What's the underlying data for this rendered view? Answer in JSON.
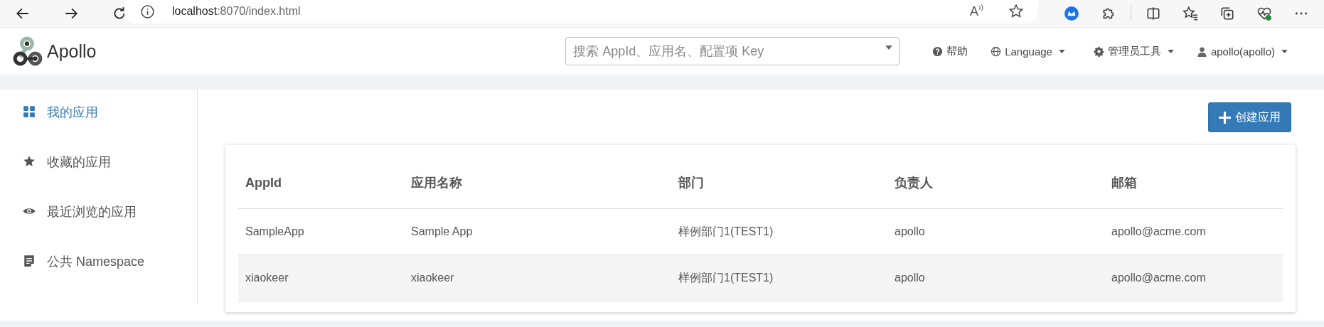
{
  "browser": {
    "url_host": "localhost",
    "url_rest": ":8070/index.html",
    "read_aloud_label": "A"
  },
  "header": {
    "logo_text": "Apollo",
    "search": {
      "placeholder": "搜索 AppId、应用名、配置项 Key"
    },
    "nav": [
      {
        "kind": "help",
        "label": "帮助",
        "dropdown": false
      },
      {
        "kind": "language",
        "label": "Language",
        "dropdown": true
      },
      {
        "kind": "admin",
        "label": "管理员工具",
        "dropdown": true
      },
      {
        "kind": "user",
        "label": "apollo(apollo)",
        "dropdown": true
      }
    ]
  },
  "sidebar": {
    "items": [
      {
        "kind": "grid",
        "label": "我的应用",
        "selected": true
      },
      {
        "kind": "star",
        "label": "收藏的应用",
        "selected": false
      },
      {
        "kind": "eye",
        "label": "最近浏览的应用",
        "selected": false
      },
      {
        "kind": "doc",
        "label": "公共 Namespace",
        "selected": false
      }
    ]
  },
  "create_button": {
    "label": "创建应用"
  },
  "table": {
    "columns": [
      "AppId",
      "应用名称",
      "部门",
      "负责人",
      "邮箱"
    ],
    "rows": [
      [
        "SampleApp",
        "Sample App",
        "样例部门1(TEST1)",
        "apollo",
        "apollo@acme.com"
      ],
      [
        "xiaokeer",
        "xiaokeer",
        "样例部门1(TEST1)",
        "apollo",
        "apollo@acme.com"
      ]
    ]
  }
}
